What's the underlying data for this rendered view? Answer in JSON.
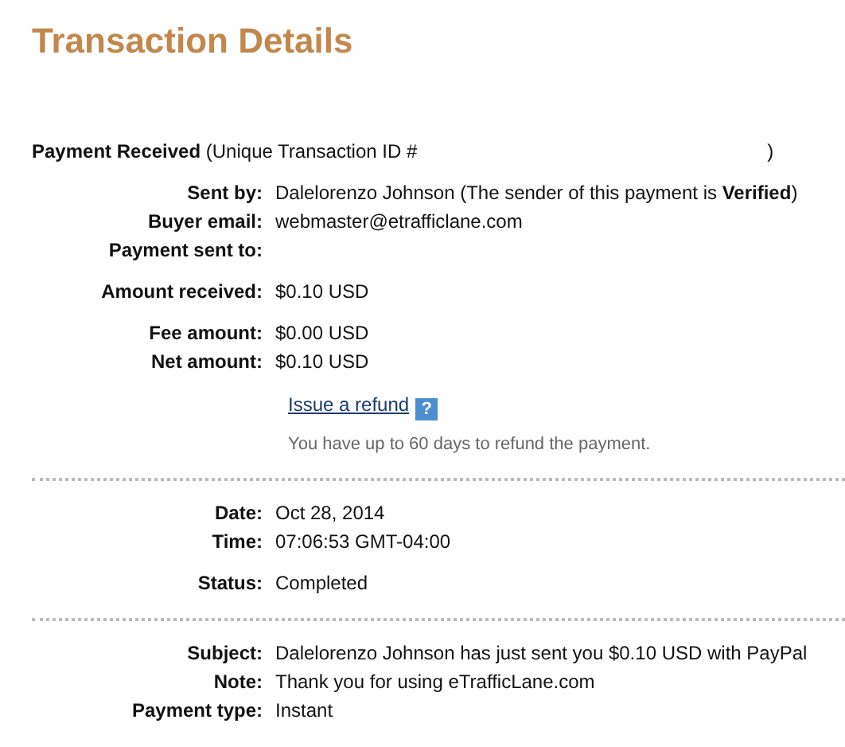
{
  "title": "Transaction Details",
  "heading": "**Payment Received** (Unique Transaction ID #",
  "heading_end": ")",
  "sections": [
    {
      "groups": [
        [
          {
            "label": "Sent by:",
            "value": "Dalelorenzo Johnson (The sender of this payment is **Verified**)"
          },
          {
            "label": "Buyer email:",
            "value": "webmaster@etrafficlane.com"
          },
          {
            "label": "Payment sent to:"
          }
        ],
        [
          {
            "label": "Amount received:",
            "value": "$0.10 USD"
          }
        ],
        [
          {
            "label": "Fee amount:",
            "value": "$0.00 USD"
          },
          {
            "label": "Net amount:",
            "value": "$0.10 USD"
          }
        ]
      ],
      "refund": {
        "link": "Issue a refund",
        "help": "?",
        "note": "You have up to 60 days to refund the payment."
      }
    },
    {
      "groups": [
        [
          {
            "label": "Date:",
            "value": "Oct 28, 2014"
          },
          {
            "label": "Time:",
            "value": "07:06:53 GMT-04:00"
          }
        ],
        [
          {
            "label": "Status:",
            "value": "Completed"
          }
        ]
      ]
    },
    {
      "groups": [
        [
          {
            "label": "Subject:",
            "value": "Dalelorenzo Johnson has just sent you $0.10 USD with PayPal"
          },
          {
            "label": "Note:",
            "value": "Thank you for using eTrafficLane.com"
          },
          {
            "label": "Payment type:",
            "value": "Instant"
          }
        ]
      ]
    }
  ]
}
